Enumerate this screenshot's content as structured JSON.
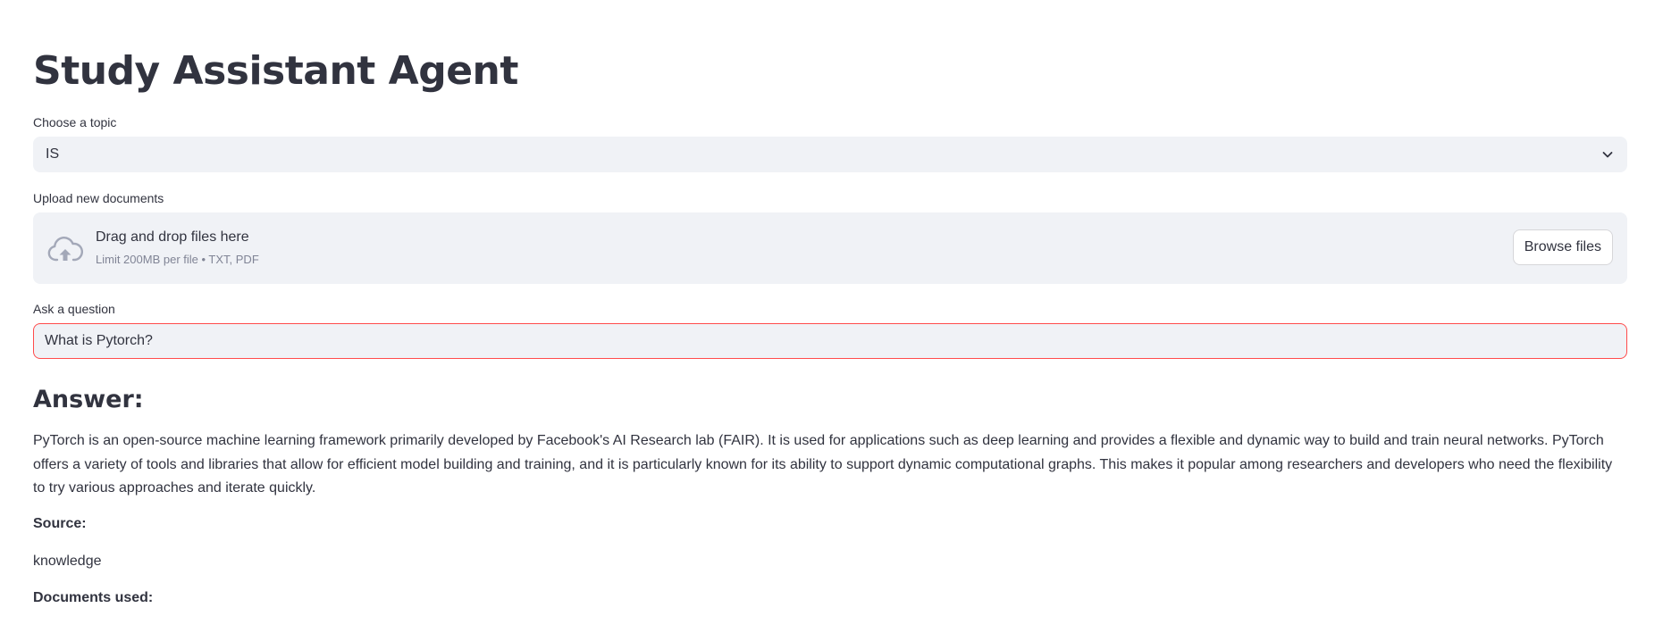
{
  "app": {
    "title": "Study Assistant Agent"
  },
  "topic_select": {
    "label": "Choose a topic",
    "value": "IS",
    "icon": "chevron-down-icon"
  },
  "uploader": {
    "label": "Upload new documents",
    "drop_text": "Drag and drop files here",
    "hint": "Limit 200MB per file • TXT, PDF",
    "button_label": "Browse files",
    "icon": "cloud-upload-icon"
  },
  "question": {
    "label": "Ask a question",
    "value": "What is Pytorch?"
  },
  "answer": {
    "heading": "Answer:",
    "text": "PyTorch is an open-source machine learning framework primarily developed by Facebook's AI Research lab (FAIR). It is used for applications such as deep learning and provides a flexible and dynamic way to build and train neural networks. PyTorch offers a variety of tools and libraries that allow for efficient model building and training, and it is particularly known for its ability to support dynamic computational graphs. This makes it popular among researchers and developers who need the flexibility to try various approaches and iterate quickly.",
    "source_label": "Source:",
    "source_value": "knowledge",
    "documents_label": "Documents used:"
  },
  "colors": {
    "text": "#31333f",
    "input_bg": "#f0f2f6",
    "focus_border": "#ff4b4b",
    "muted": "#808495"
  }
}
